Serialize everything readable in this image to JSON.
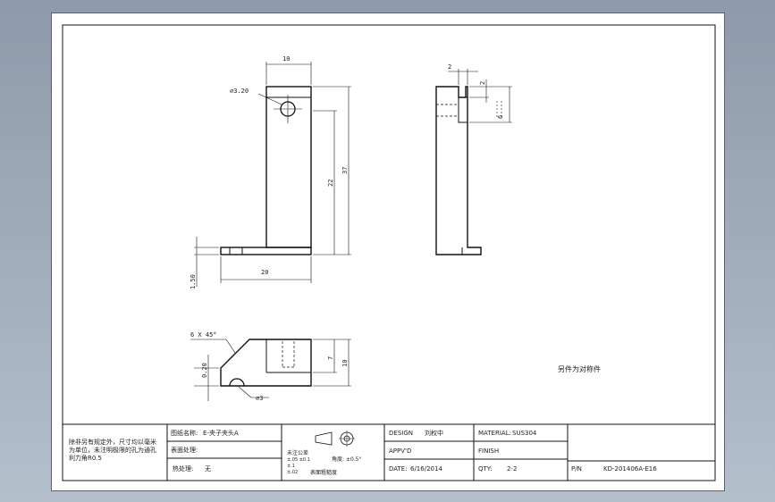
{
  "dimensions": {
    "width_top": "10",
    "hole_diameter": "∅3.20",
    "height_22": "22",
    "height_37": "37",
    "base_thickness": "1.50",
    "base_width": "20",
    "side_step": "2",
    "side_notch_depth": "2",
    "side_notch_height": "6",
    "chamfer": "6 X 45°",
    "bottom_height_7": "7",
    "bottom_height_10": "10",
    "bottom_offset": "0.20",
    "bottom_hole": "∅3"
  },
  "note": {
    "side_label": "另件为对称件"
  },
  "title_block": {
    "tech_req_lines": [
      "除非另有规定外，尺寸均以毫米",
      "为单位，未注明极限的孔为通孔",
      "利力角R0.5"
    ],
    "part_name_label": "图纸名称:",
    "part_name_value": "E-夹子夹头A",
    "surface_label": "表面处理:",
    "heat_label": "热处理:",
    "heat_value": "无",
    "tolerance_title": "未注公差",
    "tolerance_lines": [
      "±.05  ±0.1",
      "±.1",
      "±.02"
    ],
    "angle_label": "角度: ±0.5°",
    "roughness_label": "表面粗糙度",
    "design_label": "DESIGN",
    "design_value": "刘权中",
    "material_label": "MATERIAL:",
    "material_value": "SUS304",
    "approved_label": "APPV'D",
    "finish_label": "FINISH",
    "date_label": "DATE:",
    "date_value": "6/16/2014",
    "qty_label": "QTY:",
    "qty_value": "2-2",
    "pn_label": "P/N",
    "pn_value": "KD-201406A-E16"
  },
  "colors": {
    "background": "#9aa6b6",
    "sheet": "#ffffff",
    "line": "#111111"
  }
}
